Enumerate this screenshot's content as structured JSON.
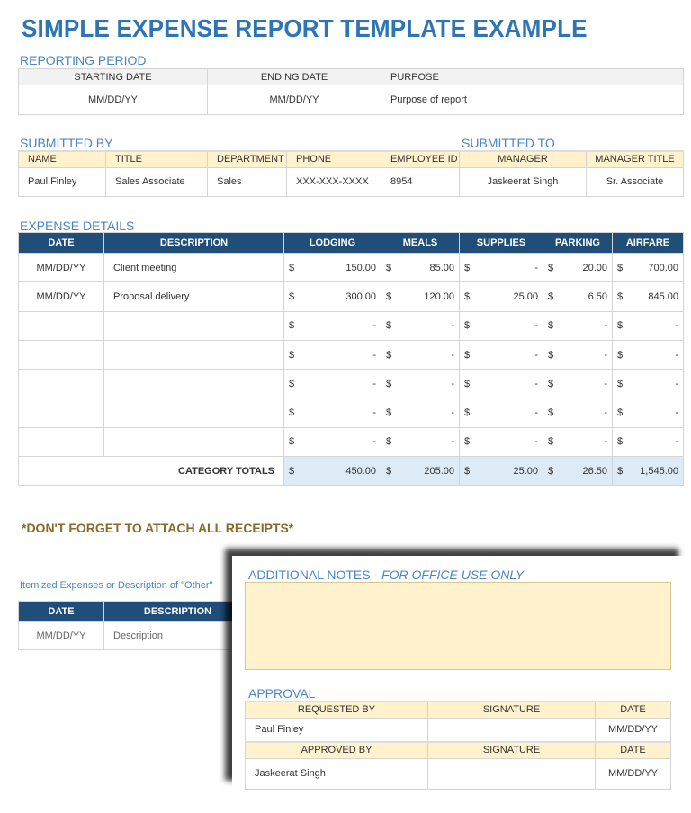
{
  "title": "SIMPLE EXPENSE REPORT TEMPLATE EXAMPLE",
  "reporting_period": {
    "label": "REPORTING PERIOD",
    "headers": [
      "STARTING DATE",
      "ENDING DATE",
      "PURPOSE"
    ],
    "values": [
      "MM/DD/YY",
      "MM/DD/YY",
      "Purpose of report"
    ]
  },
  "submitted": {
    "by_label": "SUBMITTED BY",
    "to_label": "SUBMITTED TO",
    "headers": [
      "NAME",
      "TITLE",
      "DEPARTMENT",
      "PHONE",
      "EMPLOYEE ID",
      "MANAGER",
      "MANAGER TITLE"
    ],
    "values": [
      "Paul Finley",
      "Sales Associate",
      "Sales",
      "XXX-XXX-XXXX",
      "8954",
      "Jaskeerat Singh",
      "Sr. Associate"
    ]
  },
  "expenses": {
    "label": "EXPENSE DETAILS",
    "headers": [
      "DATE",
      "DESCRIPTION",
      "LODGING",
      "MEALS",
      "SUPPLIES",
      "PARKING",
      "AIRFARE"
    ],
    "currency": "$",
    "rows": [
      {
        "date": "MM/DD/YY",
        "description": "Client meeting",
        "amounts": [
          "150.00",
          "85.00",
          "-",
          "20.00",
          "700.00"
        ]
      },
      {
        "date": "MM/DD/YY",
        "description": "Proposal delivery",
        "amounts": [
          "300.00",
          "120.00",
          "25.00",
          "6.50",
          "845.00"
        ]
      },
      {
        "date": "",
        "description": "",
        "amounts": [
          "-",
          "-",
          "-",
          "-",
          "-"
        ]
      },
      {
        "date": "",
        "description": "",
        "amounts": [
          "-",
          "-",
          "-",
          "-",
          "-"
        ]
      },
      {
        "date": "",
        "description": "",
        "amounts": [
          "-",
          "-",
          "-",
          "-",
          "-"
        ]
      },
      {
        "date": "",
        "description": "",
        "amounts": [
          "-",
          "-",
          "-",
          "-",
          "-"
        ]
      },
      {
        "date": "",
        "description": "",
        "amounts": [
          "-",
          "-",
          "-",
          "-",
          "-"
        ]
      }
    ],
    "totals_label": "CATEGORY TOTALS",
    "totals": [
      "450.00",
      "205.00",
      "25.00",
      "26.50",
      "1,545.00"
    ]
  },
  "receipts_note": "*DON'T FORGET TO ATTACH ALL RECEIPTS*",
  "itemized": {
    "label": "Itemized Expenses or Description of \"Other\"",
    "headers": [
      "DATE",
      "DESCRIPTION"
    ],
    "values": [
      "MM/DD/YY",
      "Description"
    ]
  },
  "notes": {
    "label": "ADDITIONAL NOTES - ",
    "label_italic": "FOR OFFICE USE ONLY"
  },
  "approval": {
    "label": "APPROVAL",
    "requested_headers": [
      "REQUESTED BY",
      "SIGNATURE",
      "DATE"
    ],
    "requested_values": [
      "Paul Finley",
      "",
      "MM/DD/YY"
    ],
    "approved_headers": [
      "APPROVED BY",
      "SIGNATURE",
      "DATE"
    ],
    "approved_values": [
      "Jaskeerat Singh",
      "",
      "MM/DD/YY"
    ]
  }
}
